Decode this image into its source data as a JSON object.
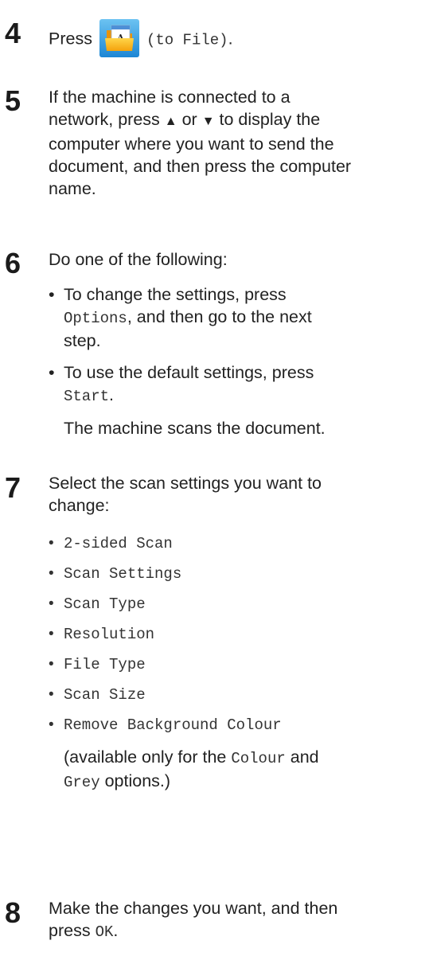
{
  "step4": {
    "number": "4",
    "press": "Press",
    "icon": "to-file-icon",
    "icon_letter": "A",
    "code": "(to File)",
    "end": "."
  },
  "step5": {
    "number": "5",
    "line1": "If the machine is connected to a",
    "line2_a": "network, press ",
    "up": "▲",
    "or": " or ",
    "down": "▼",
    "line2_b": " to display the",
    "line3": "computer where you want to send the",
    "line4": "document, and then press the computer",
    "line5": "name."
  },
  "step6": {
    "number": "6",
    "intro": "Do one of the following:",
    "bullet_char": "•",
    "b1_line1": "To change the settings, press",
    "b1_code": "Options",
    "b1_rest": ", and then go to the next",
    "b1_line3": "step.",
    "b2_line1": "To use the default settings, press",
    "b2_code": "Start",
    "b2_end": ".",
    "after": "The machine scans the document."
  },
  "step7": {
    "number": "7",
    "line1": "Select the scan settings you want to",
    "line2": "change:",
    "items": [
      "2-sided Scan",
      "Scan Settings",
      "Scan Type",
      "Resolution",
      "File Type",
      "Scan Size",
      "Remove Background Colour"
    ],
    "note_a": "(available only for the ",
    "note_colour": "Colour",
    "note_and": " and",
    "note_grey": "Grey",
    "note_b": " options.)"
  },
  "step8": {
    "number": "8",
    "line1": "Make the changes you want, and then",
    "line2_a": "press ",
    "line2_code": "OK",
    "line2_end": "."
  }
}
